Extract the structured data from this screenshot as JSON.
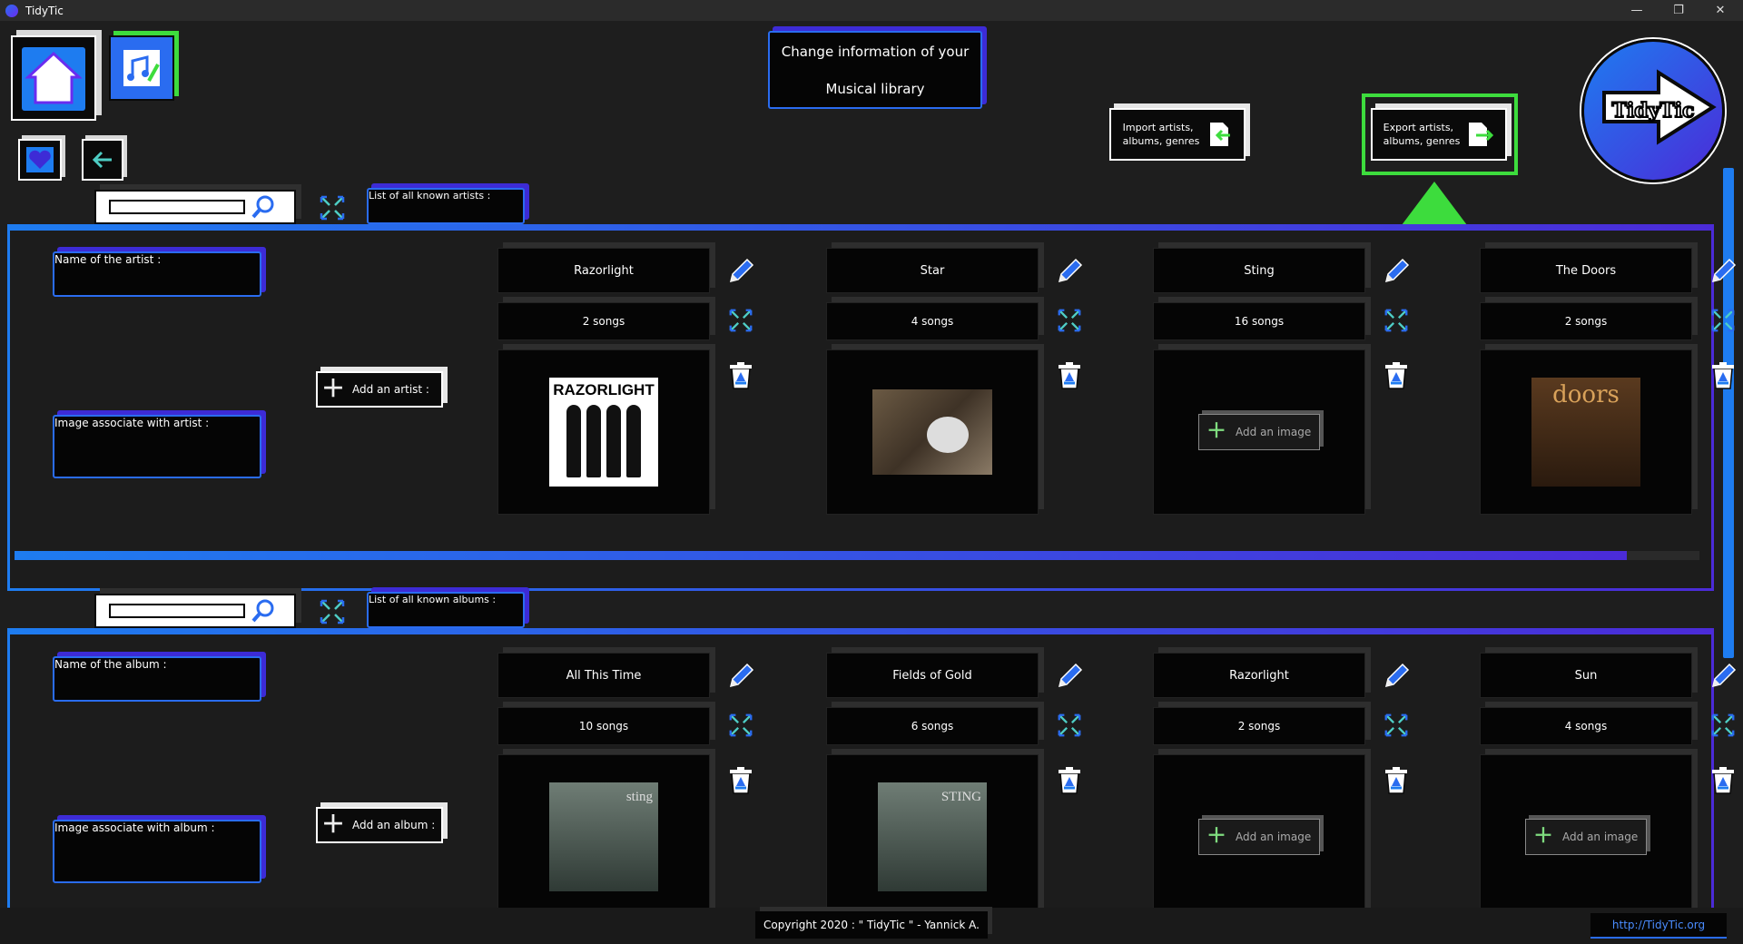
{
  "window": {
    "title": "TidyTic",
    "minimize": "—",
    "restore": "❐",
    "close": "✕"
  },
  "header": {
    "title_line1": "Change information of your",
    "title_line2": "Musical library",
    "import_label_line1": "Import artists,",
    "import_label_line2": "albums, genres",
    "export_label_line1": "Export artists,",
    "export_label_line2": "albums, genres",
    "logo_text": "TidyTic"
  },
  "colors": {
    "accent_blue": "#2a6cf0",
    "accent_purple": "#4b2bd8",
    "highlight_green": "#3ddc3d"
  },
  "artists": {
    "list_label": "List of all known artists :",
    "name_label": "Name of the artist :",
    "image_label": "Image associate with artist :",
    "add_button": "Add an artist :",
    "items": [
      {
        "name": "Razorlight",
        "songs": "2 songs",
        "image": "razorlight",
        "image_text": "RAZORLIGHT"
      },
      {
        "name": "Star",
        "songs": "4 songs",
        "image": "photo"
      },
      {
        "name": "Sting",
        "songs": "16 songs",
        "image": "none",
        "add_image": "Add an image"
      },
      {
        "name": "The Doors",
        "songs": "2 songs",
        "image": "doors",
        "image_text": "doors"
      }
    ]
  },
  "albums": {
    "list_label": "List of all known albums :",
    "name_label": "Name of the album :",
    "image_label": "Image associate with album :",
    "add_button": "Add an album :",
    "items": [
      {
        "name": "All This Time",
        "songs": "10 songs",
        "image": "cover",
        "image_text": "sting"
      },
      {
        "name": "Fields of Gold",
        "songs": "6 songs",
        "image": "cover",
        "image_text": "STING"
      },
      {
        "name": "Razorlight",
        "songs": "2 songs",
        "image": "none",
        "add_image": "Add an image"
      },
      {
        "name": "Sun",
        "songs": "4 songs",
        "image": "none",
        "add_image": "Add an image"
      }
    ]
  },
  "footer": {
    "copyright": "Copyright 2020 : \" TidyTic \" - Yannick A.",
    "link": "http://TidyTic.org"
  }
}
